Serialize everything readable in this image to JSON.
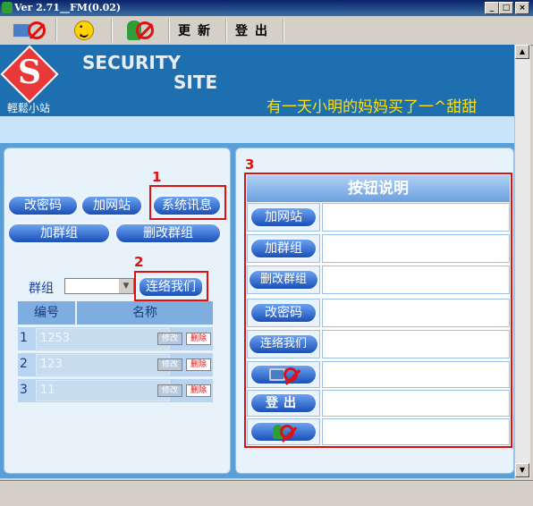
{
  "window": {
    "title": "Ver 2.71__FM(0.02)",
    "controls": [
      "_",
      "□",
      "×"
    ]
  },
  "toolbar": {
    "buttons": [
      {
        "icon": "monitor-no-icon"
      },
      {
        "icon": "smiley-icon"
      },
      {
        "icon": "dino-no-icon"
      },
      {
        "label": "更新"
      },
      {
        "label": "登出"
      }
    ]
  },
  "banner": {
    "logo_letter": "S",
    "brand_line1": "SECURITY",
    "brand_line2": "SITE",
    "subtitle": "輕鬆小站",
    "marquee": "有一天小明的妈妈买了一^甜甜"
  },
  "annotations": {
    "n1": "1",
    "n2": "2",
    "n3": "3"
  },
  "left_panel": {
    "btn_change_password": "改密码",
    "btn_add_site": "加网站",
    "btn_system_info": "系统讯息",
    "btn_add_group": "加群组",
    "btn_edit_group": "删改群组",
    "group_label": "群组",
    "group_select_value": "",
    "btn_contact": "连络我们",
    "table": {
      "col_number": "编号",
      "col_name": "名称",
      "rows": [
        {
          "num": "1",
          "name": "1253",
          "edit": "修改",
          "delete": "删除"
        },
        {
          "num": "2",
          "name": "123",
          "edit": "修改",
          "delete": "删除"
        },
        {
          "num": "3",
          "name": "11",
          "edit": "修改",
          "delete": "删除"
        }
      ]
    }
  },
  "right_panel": {
    "header": "按钮说明",
    "rows": [
      {
        "label": "加网站",
        "desc": ""
      },
      {
        "label": "加群组",
        "desc": ""
      },
      {
        "label": "删改群组",
        "desc": ""
      },
      {
        "label": "改密码",
        "desc": ""
      },
      {
        "label": "连络我们",
        "desc": ""
      },
      {
        "icon": "monitor-no-icon",
        "desc": ""
      },
      {
        "label": "登出",
        "desc": ""
      },
      {
        "icon": "dino-no-icon",
        "desc": ""
      }
    ]
  },
  "colors": {
    "accent": "#1e6fb0",
    "annotation": "#e01010",
    "marquee": "#ffe000"
  }
}
